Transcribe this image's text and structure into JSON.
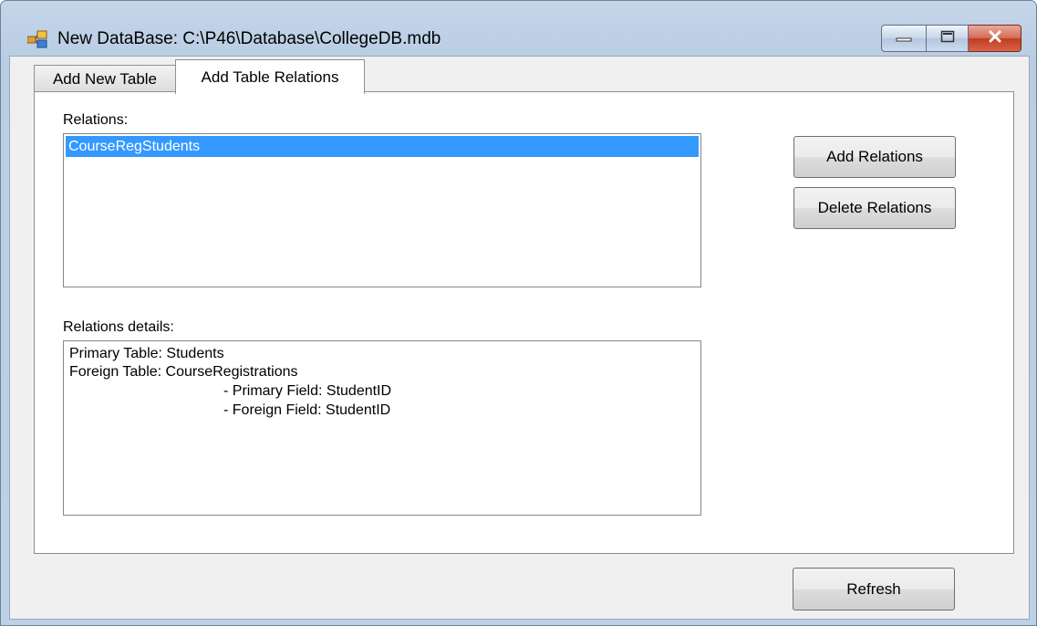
{
  "window": {
    "title": "New DataBase: C:\\P46\\Database\\CollegeDB.mdb"
  },
  "tabs": [
    {
      "label": "Add New Table",
      "active": false
    },
    {
      "label": "Add Table Relations",
      "active": true
    }
  ],
  "relations": {
    "label": "Relations:",
    "items": [
      "CourseRegStudents"
    ],
    "selected_index": 0
  },
  "details": {
    "label": "Relations details:",
    "lines": [
      "Primary Table: Students",
      "Foreign Table: CourseRegistrations",
      "- Primary Field: StudentID",
      "- Foreign Field: StudentID"
    ]
  },
  "buttons": {
    "add_relations": "Add Relations",
    "delete_relations": "Delete Relations",
    "refresh": "Refresh"
  },
  "colors": {
    "selection": "#3399ff",
    "window_frame": "#bcd0e6",
    "close_button": "#c23b1f"
  }
}
